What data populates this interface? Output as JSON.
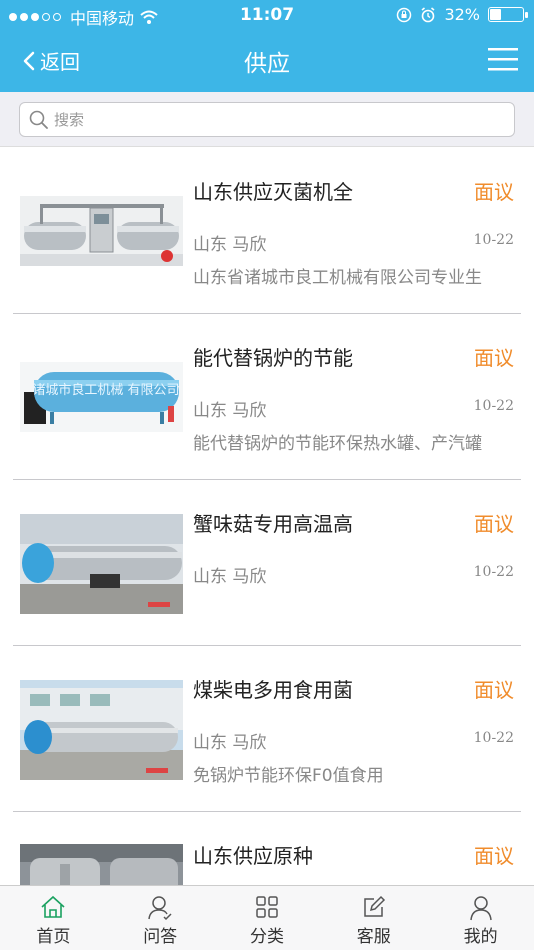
{
  "status_bar": {
    "carrier": "中国移动",
    "time": "11:07",
    "battery_percent": "32%",
    "battery_level": 0.32
  },
  "nav": {
    "back_label": "返回",
    "title": "供应"
  },
  "search": {
    "placeholder": "搜索"
  },
  "items": [
    {
      "title": "山东供应灭菌机全",
      "price": "面议",
      "location": "山东 马欣",
      "date": "10-22",
      "desc": "山东省诸城市良工机械有限公司专业生",
      "image": "twin-autoclave"
    },
    {
      "title": "能代替锅炉的节能",
      "price": "面议",
      "location": "山东 马欣",
      "date": "10-22",
      "desc": "能代替锅炉的节能环保热水罐、产汽罐",
      "image": "blue-tank",
      "image_text": "诸城市良工机械 有限公司"
    },
    {
      "title": "蟹味菇专用高温高",
      "price": "面议",
      "location": "山东 马欣",
      "date": "10-22",
      "desc": "",
      "image": "outdoor-autoclave"
    },
    {
      "title": "煤柴电多用食用菌",
      "price": "面议",
      "location": "山东 马欣",
      "date": "10-22",
      "desc": "免锅炉节能环保F0值食用",
      "image": "yard-autoclave"
    },
    {
      "title": "山东供应原种",
      "price": "面议",
      "location": "",
      "date": "",
      "desc": "",
      "image": "indoor-autoclave"
    }
  ],
  "tabbar": [
    {
      "label": "首页",
      "icon": "home-icon",
      "active": true
    },
    {
      "label": "问答",
      "icon": "user-question-icon"
    },
    {
      "label": "分类",
      "icon": "grid-icon"
    },
    {
      "label": "客服",
      "icon": "edit-icon"
    },
    {
      "label": "我的",
      "icon": "user-icon"
    }
  ],
  "colors": {
    "header": "#3db6e7",
    "price": "#f08c2c",
    "active_tab": "#1aa160"
  }
}
